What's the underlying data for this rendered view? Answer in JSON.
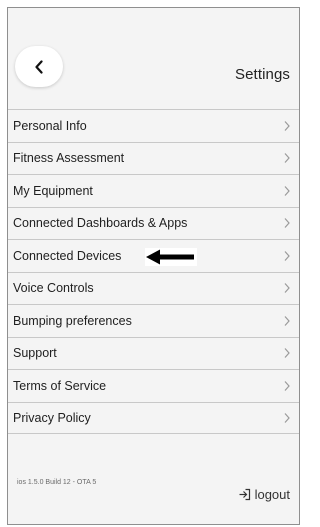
{
  "header": {
    "title": "Settings"
  },
  "menu": {
    "items": [
      {
        "label": "Personal Info"
      },
      {
        "label": "Fitness Assessment"
      },
      {
        "label": "My Equipment"
      },
      {
        "label": "Connected Dashboards & Apps"
      },
      {
        "label": "Connected Devices"
      },
      {
        "label": "Voice Controls"
      },
      {
        "label": "Bumping preferences"
      },
      {
        "label": "Support"
      },
      {
        "label": "Terms of Service"
      },
      {
        "label": "Privacy Policy"
      }
    ]
  },
  "footer": {
    "version": "ios 1.5.0 Build 12 - OTA 5",
    "logout_label": "logout"
  },
  "icons": {
    "back": "chevron-left-icon",
    "row": "chevron-right-icon",
    "logout": "logout-icon",
    "annotation": "arrow-left-icon"
  },
  "colors": {
    "background": "#f4f4f4",
    "divider": "#c8c8c8",
    "text": "#1f1f1f",
    "chevron": "#9a9a9a"
  }
}
